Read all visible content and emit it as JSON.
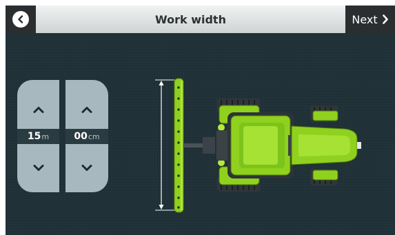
{
  "header": {
    "title": "Work width",
    "next_label": "Next"
  },
  "icons": {
    "back": "chevron-left-icon",
    "next": "chevron-right-icon",
    "increase": "chevron-up-icon",
    "decrease": "chevron-down-icon"
  },
  "width_selector": {
    "meters": {
      "value": "15",
      "unit": "m"
    },
    "centimeters": {
      "value": "00",
      "unit": "cm"
    }
  },
  "colors": {
    "background": "#1f3036",
    "accent_green": "#8fd11e",
    "panel": "#a7b9be",
    "header_bar": "#e6e9ea",
    "dark_button": "#2a2e30"
  }
}
